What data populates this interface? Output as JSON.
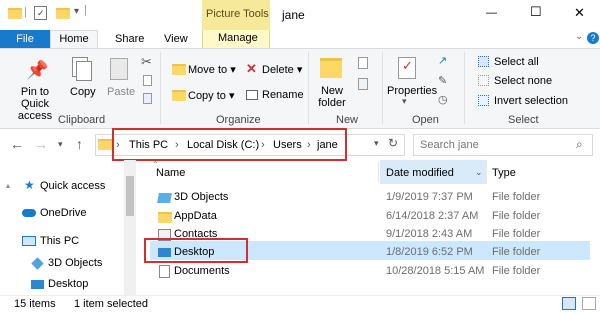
{
  "window": {
    "contextual_tab": "Picture Tools",
    "title": "jane",
    "controls": {
      "minimize": "—",
      "maximize": "☐",
      "close": "✕"
    }
  },
  "tabs": [
    "File",
    "Home",
    "Share",
    "View",
    "Manage"
  ],
  "ribbon": {
    "clipboard": {
      "pin_label": "Pin to Quick access",
      "copy": "Copy",
      "paste": "Paste",
      "group": "Clipboard"
    },
    "organize": {
      "move_to": "Move to",
      "copy_to": "Copy to",
      "delete": "Delete",
      "rename": "Rename",
      "group": "Organize"
    },
    "new": {
      "new_folder": "New folder",
      "group": "New"
    },
    "open": {
      "properties": "Properties",
      "group": "Open"
    },
    "select": {
      "select_all": "Select all",
      "select_none": "Select none",
      "invert": "Invert selection",
      "group": "Select"
    }
  },
  "address": {
    "crumbs": [
      "This PC",
      "Local Disk (C:)",
      "Users",
      "jane"
    ],
    "search_placeholder": "Search jane"
  },
  "nav_pane": [
    {
      "label": "Quick access",
      "icon": "star-icon"
    },
    {
      "label": "OneDrive",
      "icon": "cloud-icon"
    },
    {
      "label": "This PC",
      "icon": "computer-icon"
    },
    {
      "label": "3D Objects",
      "icon": "cube-icon"
    },
    {
      "label": "Desktop",
      "icon": "desktop-icon"
    }
  ],
  "columns": {
    "name": "Name",
    "date": "Date modified",
    "type": "Type"
  },
  "files": [
    {
      "name": "3D Objects",
      "date": "1/9/2019 7:37 PM",
      "type": "File folder"
    },
    {
      "name": "AppData",
      "date": "6/14/2018 2:37 AM",
      "type": "File folder"
    },
    {
      "name": "Contacts",
      "date": "9/1/2018 2:43 AM",
      "type": "File folder"
    },
    {
      "name": "Desktop",
      "date": "1/8/2019 6:52 PM",
      "type": "File folder"
    },
    {
      "name": "Documents",
      "date": "10/28/2018 5:15 AM",
      "type": "File folder"
    }
  ],
  "status": {
    "count": "15 items",
    "selected": "1 item selected"
  },
  "colors": {
    "file_tab": "#1979ca",
    "contextual": "#f6e99a",
    "selection": "#cce8ff",
    "highlight_box": "#d32f2f"
  }
}
